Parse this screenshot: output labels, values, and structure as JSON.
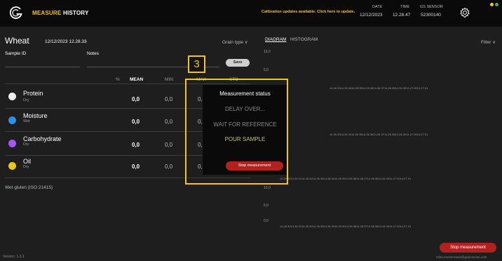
{
  "topbar": {
    "nav": {
      "measure": "MEASURE",
      "history": "HISTORY"
    },
    "calibration_notice": "Calibration updates available. Click here to update.",
    "date_label": "DATE",
    "date_value": "12/12/2023",
    "time_label": "TIME",
    "time_value": "12.28.47",
    "sensor_label": "GS SENSOR",
    "sensor_value": "52300140",
    "colors": {
      "accent": "#f0c418",
      "status_dot_1": "#f5c51b",
      "status_dot_2": "#3fb54a"
    }
  },
  "sample": {
    "product": "Wheat",
    "date": "12/12/2023 12.28.33",
    "sample_id_label": "Sample ID",
    "notes_label": "Notes",
    "grain_type": "Grain type ∨",
    "save_label": "Save"
  },
  "table": {
    "headers": [
      "%",
      "MEAN",
      "MIN",
      "MAX",
      "STD"
    ],
    "rows": [
      {
        "name": "Protein",
        "basis": "Dry",
        "mean": "0,0",
        "min": "0,0",
        "max": "0,0",
        "color": "#eeeeee"
      },
      {
        "name": "Moisture",
        "basis": "Wet",
        "mean": "0,0",
        "min": "0,0",
        "max": "0,0",
        "color": "#2f8ee8"
      },
      {
        "name": "Carbohydrate",
        "basis": "Dry",
        "mean": "0,0",
        "min": "0,0",
        "max": "0,0",
        "color": "#a855f7"
      },
      {
        "name": "Oil",
        "basis": "Dry",
        "mean": "0,0",
        "min": "0,0",
        "max": "0,0",
        "color": "#f0c418"
      }
    ],
    "wet_gluten": "Wet gluten (ISO 21415)"
  },
  "diagram": {
    "tab_diagram": "DIAGRAM",
    "tab_histogram": "HISTOGRAM",
    "filter": "Filter ∨",
    "y_ticks": [
      "10,0",
      "5,0",
      "0,0"
    ],
    "x_ticks_full": [
      "14.26.30",
      "14.26.31",
      "14.26.32",
      "14.26.33",
      "14.26.34",
      "14.26.35",
      "14.26.36",
      "14.26.37",
      "14.26.38",
      "14.26.39",
      "14.27.00",
      "14.27.01"
    ],
    "x_ticks_partial": [
      "14.26.33",
      "14.26.34",
      "14.26.35",
      "14.26.36",
      "14.26.37",
      "14.26.38",
      "14.26.39",
      "14.27.00",
      "14.27.01"
    ]
  },
  "modal": {
    "title": "Measurement status",
    "step_1": "DELAY OVER...",
    "step_2": "WAIT FOR REFERENCE",
    "step_3": "POUR SAMPLE",
    "stop_label": "Stop measurement"
  },
  "annotation": {
    "badge": "3"
  },
  "footer": {
    "version": "Version: 1.3.1",
    "stop_label": "Stop measurement",
    "user_email": "erika.mustermann@grainsense.com"
  }
}
